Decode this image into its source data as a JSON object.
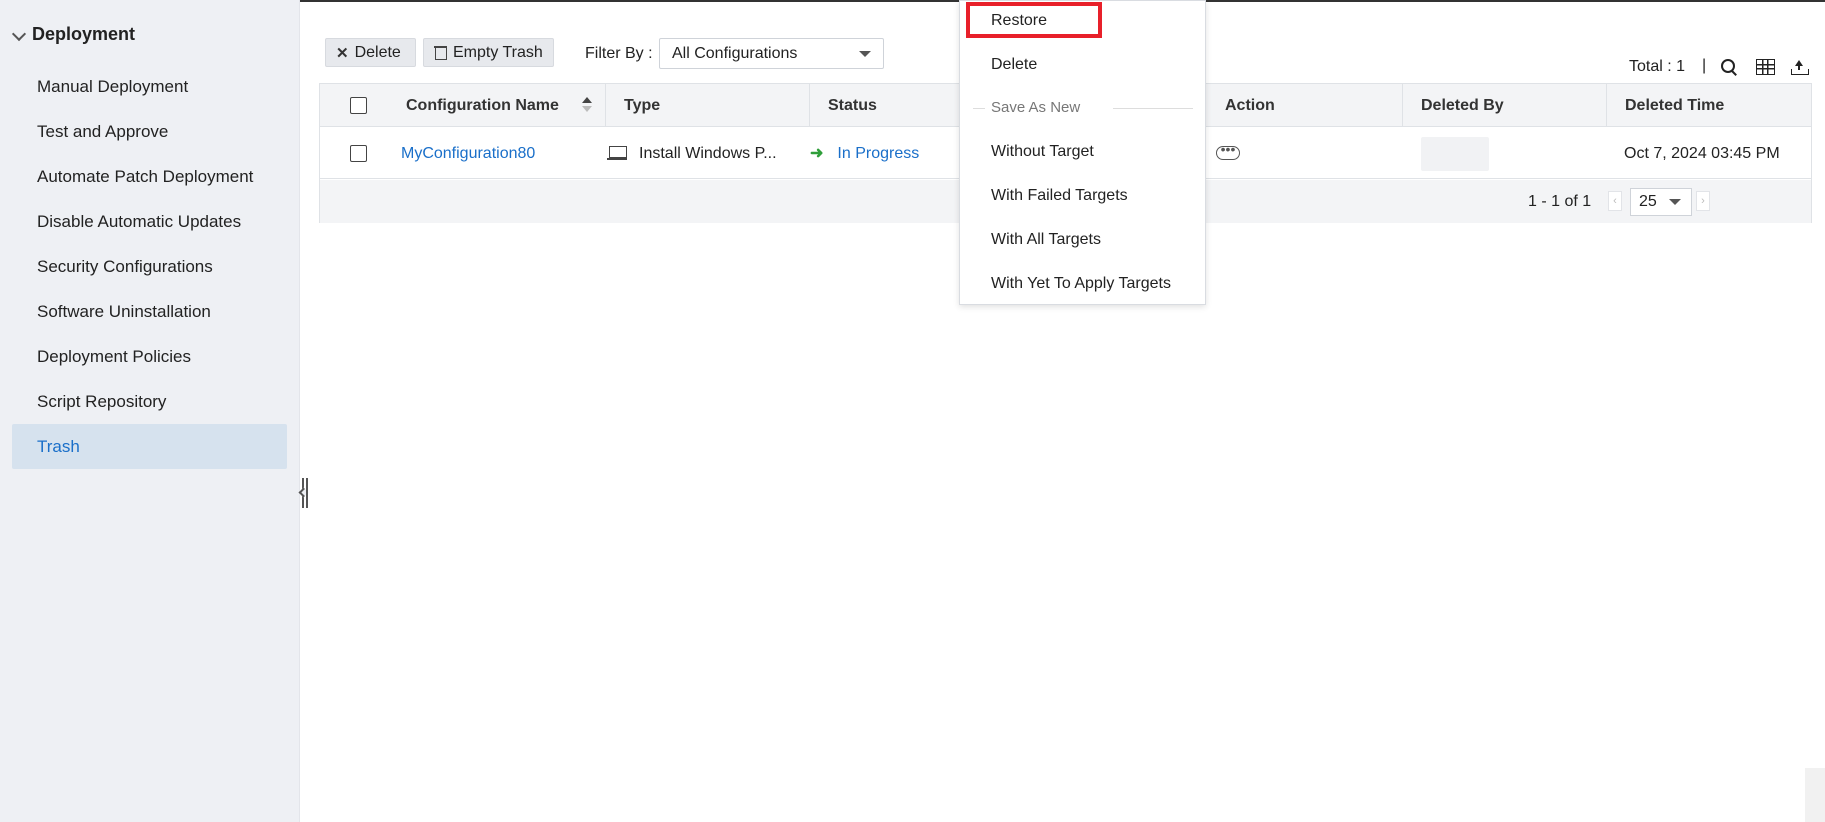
{
  "sidebar": {
    "title": "Deployment",
    "items": [
      {
        "label": "Manual Deployment"
      },
      {
        "label": "Test and Approve"
      },
      {
        "label": "Automate Patch Deployment"
      },
      {
        "label": "Disable Automatic Updates"
      },
      {
        "label": "Security Configurations"
      },
      {
        "label": "Software Uninstallation"
      },
      {
        "label": "Deployment Policies"
      },
      {
        "label": "Script Repository"
      },
      {
        "label": "Trash",
        "active": true
      }
    ]
  },
  "toolbar": {
    "delete_label": "Delete",
    "empty_trash_label": "Empty Trash",
    "filter_label": "Filter By :",
    "filter_value": "All Configurations",
    "total_label": "Total : 1",
    "separator": "|"
  },
  "table": {
    "columns": [
      "Configuration Name",
      "Type",
      "Status",
      "Action",
      "Deleted By",
      "Deleted Time"
    ],
    "rows": [
      {
        "name": "MyConfiguration80",
        "type": "Install Windows P...",
        "status": "In Progress",
        "deleted_by": "",
        "deleted_time": "Oct 7, 2024 03:45 PM"
      }
    ],
    "pagination": {
      "range": "1 - 1 of 1",
      "page_size": "25",
      "prev": "‹",
      "next": "›"
    }
  },
  "menu": {
    "restore": "Restore",
    "delete": "Delete",
    "group_label": "Save As New",
    "without_target": "Without Target",
    "with_failed": "With Failed Targets",
    "with_all": "With All Targets",
    "with_yet": "With Yet To Apply Targets"
  },
  "colors": {
    "accent": "#1a6fc9",
    "highlight": "#e8202a",
    "status_arrow": "#2f9e3a",
    "sidebar_bg": "#eef0f4",
    "active_bg": "#d6e2ee"
  }
}
